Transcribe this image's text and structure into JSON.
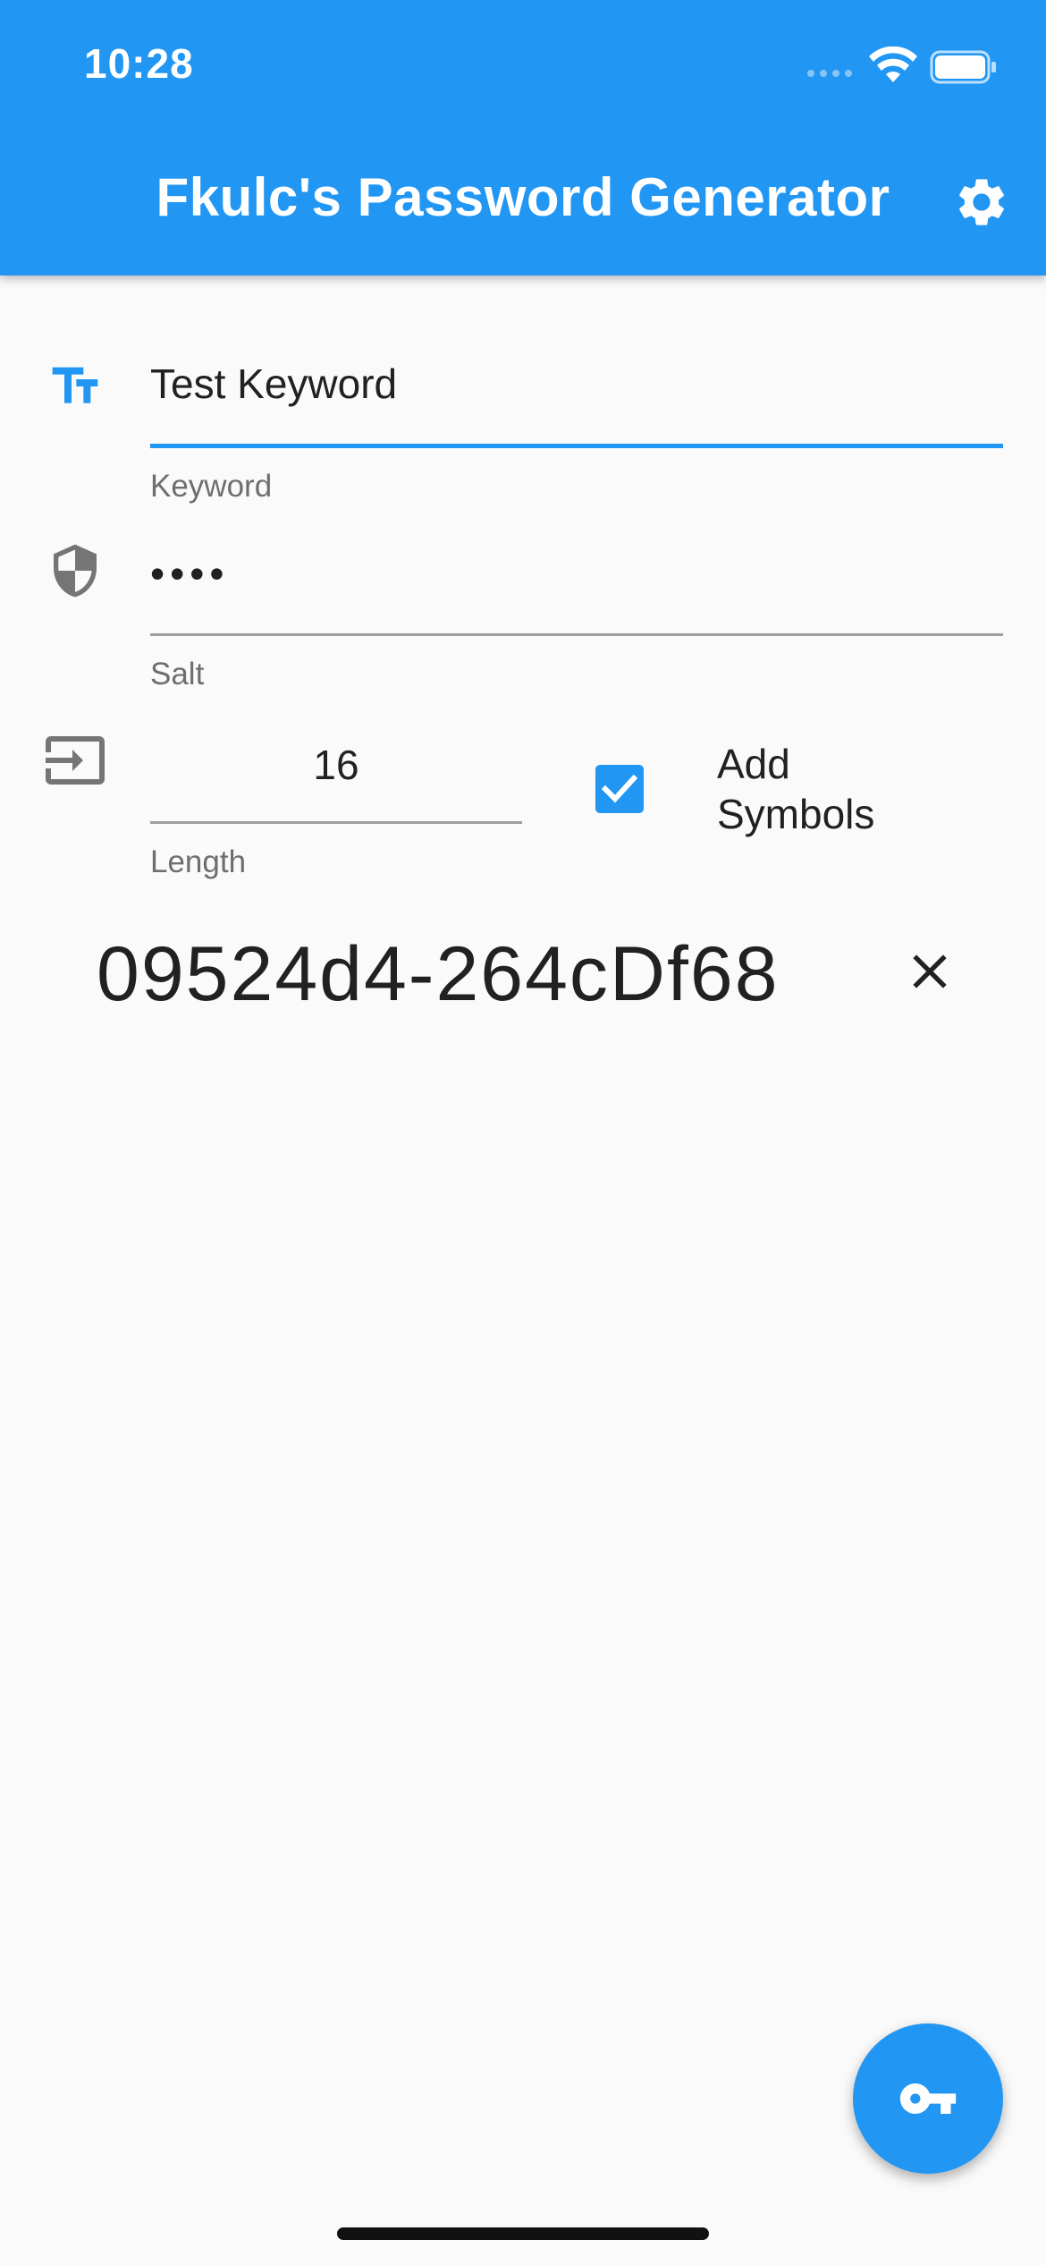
{
  "status_bar": {
    "time": "10:28"
  },
  "app_bar": {
    "title": "Fkulc's Password Generator",
    "settings_icon": "gear-icon"
  },
  "form": {
    "keyword": {
      "value": "Test Keyword",
      "label": "Keyword",
      "icon": "text-fields-icon"
    },
    "salt": {
      "value": "••••",
      "label": "Salt",
      "icon": "shield-icon"
    },
    "length": {
      "value": "16",
      "label": "Length",
      "icon": "input-icon"
    },
    "add_symbols": {
      "label": "Add Symbols",
      "checked": true
    }
  },
  "result": {
    "password": "09524d4-264cDf68",
    "clear_icon": "close-icon"
  },
  "fab": {
    "icon": "key-icon"
  },
  "colors": {
    "primary": "#2196F3",
    "background": "#FAFAFA",
    "icon_grey": "#757575"
  }
}
